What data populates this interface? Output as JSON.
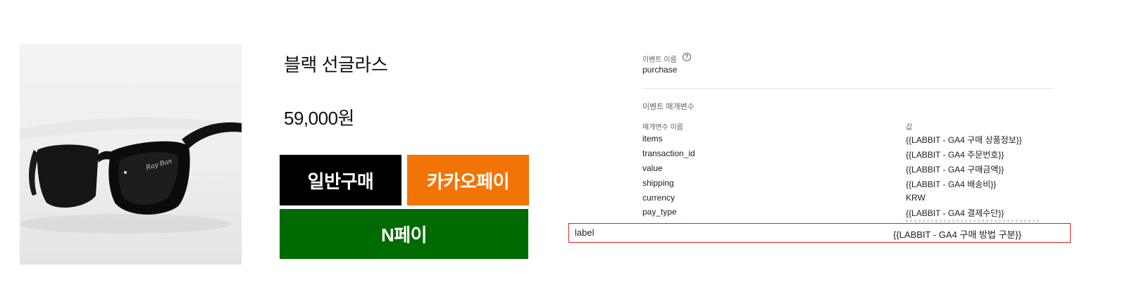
{
  "product": {
    "image_alt_icon": "sunglasses-image",
    "title": "블랙 선글라스",
    "price": "59,000원",
    "buttons": {
      "normal": "일반구매",
      "kakao": "카카오페이",
      "npay": "N페이"
    },
    "colors": {
      "normal_bg": "#000000",
      "kakao_bg": "#f27405",
      "npay_bg": "#006b00"
    }
  },
  "ga": {
    "event_name_label": "이벤트 이름",
    "help_icon": "?",
    "event_name_value": "purchase",
    "params_title": "이벤트 매개변수",
    "col_name": "매개변수 이름",
    "col_value": "값",
    "params": [
      {
        "name": "items",
        "value": "{{LABBIT - GA4 구매 상품정보}}"
      },
      {
        "name": "transaction_id",
        "value": "{{LABBIT - GA4 주문번호}}"
      },
      {
        "name": "value",
        "value": "{{LABBIT - GA4 구매금액}}"
      },
      {
        "name": "shipping",
        "value": "{{LABBIT - GA4 배송비}}"
      },
      {
        "name": "currency",
        "value": "KRW"
      },
      {
        "name": "pay_type",
        "value": "{{LABBIT - GA4 결제수단}}"
      }
    ],
    "highlighted_param": {
      "name": "label",
      "value": "{{LABBIT - GA4 구매 방법 구분}}"
    },
    "highlight_color": "#e02020"
  }
}
